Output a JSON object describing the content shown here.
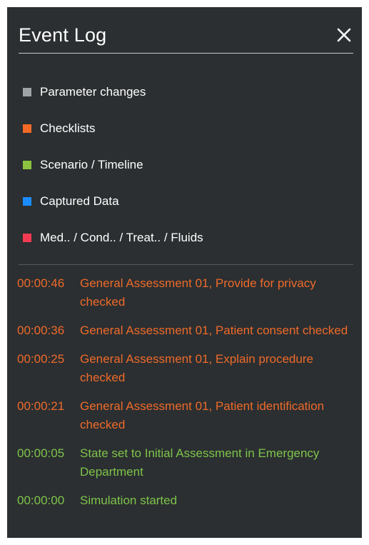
{
  "window": {
    "title": "Event Log",
    "close_icon": "close-icon"
  },
  "colors": {
    "background": "#2b2f31",
    "parameter_changes": "#9ea3a6",
    "checklists": "#f26a26",
    "scenario_timeline": "#8cc43f",
    "captured_data": "#1a8cff",
    "med_cond_treat_fluids": "#f23b52"
  },
  "legend": {
    "items": [
      {
        "label": "Parameter changes",
        "color": "#9ea3a6"
      },
      {
        "label": "Checklists",
        "color": "#f26a26"
      },
      {
        "label": "Scenario / Timeline",
        "color": "#8cc43f"
      },
      {
        "label": "Captured Data",
        "color": "#1a8cff"
      },
      {
        "label": "Med.. / Cond.. / Treat.. / Fluids",
        "color": "#f23b52"
      }
    ]
  },
  "log": {
    "entries": [
      {
        "time": "00:00:46",
        "message": "General Assessment 01, Provide for privacy checked",
        "category": "checklist"
      },
      {
        "time": "00:00:36",
        "message": "General Assessment 01, Patient consent checked",
        "category": "checklist"
      },
      {
        "time": "00:00:25",
        "message": "General Assessment 01, Explain procedure checked",
        "category": "checklist"
      },
      {
        "time": "00:00:21",
        "message": "General Assessment 01, Patient identification checked",
        "category": "checklist"
      },
      {
        "time": "00:00:05",
        "message": "State set to Initial Assessment in Emergency Department",
        "category": "scenario"
      },
      {
        "time": "00:00:00",
        "message": "Simulation started",
        "category": "scenario"
      }
    ]
  }
}
